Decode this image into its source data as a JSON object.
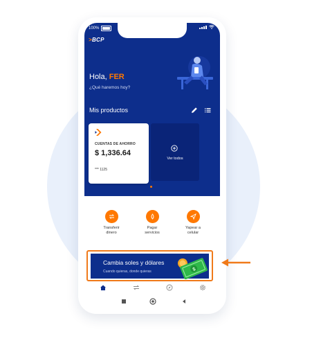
{
  "status": {
    "battery": "100%"
  },
  "brand": {
    "logo_text": "BCP",
    "logo_mark": ">",
    "accent": "#ff7800",
    "primary": "#0d2e8c"
  },
  "greeting": {
    "prefix": "Hola,",
    "name": "FER",
    "subtitle": "¿Qué haremos hoy?"
  },
  "products": {
    "title": "Mis productos",
    "card": {
      "type": "CUENTAS DE AHORRO",
      "amount": "$ 1,336.64",
      "number": "*** 1125"
    },
    "see_all": "Ver todos"
  },
  "actions": [
    {
      "line1": "Transferir",
      "line2": "dinero",
      "icon": "transfer-icon"
    },
    {
      "line1": "Pagar",
      "line2": "servicios",
      "icon": "drop-icon"
    },
    {
      "line1": "Yapear a",
      "line2": "celular",
      "icon": "send-icon"
    }
  ],
  "banner": {
    "title": "Cambia soles y dólares",
    "subtitle": "Cuando quieras, donde quieras",
    "highlight_color": "#f07a1a"
  },
  "navbar": [
    "home-icon",
    "transfer-icon",
    "compass-icon",
    "settings-icon"
  ],
  "system_nav": [
    "square-icon",
    "circle-icon",
    "back-icon"
  ]
}
